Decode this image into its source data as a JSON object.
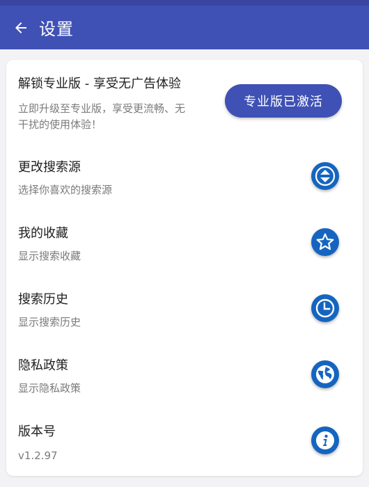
{
  "appbar": {
    "title": "设置"
  },
  "pro": {
    "title": "解锁专业版 - 享受无广告体验",
    "desc_line1": "立即升级至专业版，享受更流畅、无",
    "desc_line2": "干扰的使用体验！",
    "button_label": "专业版已激活"
  },
  "settings": [
    {
      "title": "更改搜索源",
      "subtitle": "选择你喜欢的搜索源",
      "icon": "sort-icon"
    },
    {
      "title": "我的收藏",
      "subtitle": "显示搜索收藏",
      "icon": "star-icon"
    },
    {
      "title": "搜索历史",
      "subtitle": "显示搜索历史",
      "icon": "clock-icon"
    },
    {
      "title": "隐私政策",
      "subtitle": "显示隐私政策",
      "icon": "globe-icon"
    },
    {
      "title": "版本号",
      "subtitle": "v1.2.97",
      "icon": "info-icon"
    }
  ],
  "colors": {
    "appbar": "#3f51b5",
    "icon_button": "#1565c0",
    "background": "#f3f3f5"
  }
}
